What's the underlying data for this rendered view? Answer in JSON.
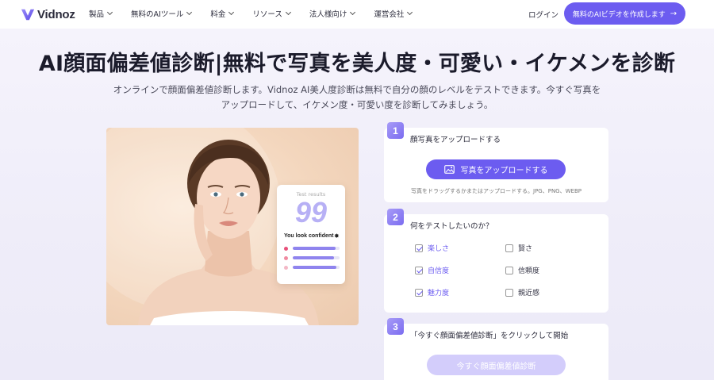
{
  "brand": {
    "name": "Vidnoz",
    "accent": "#6c5cf0"
  },
  "nav": {
    "items": [
      {
        "label": "製品"
      },
      {
        "label": "無料のAIツール"
      },
      {
        "label": "料金"
      },
      {
        "label": "リソース"
      },
      {
        "label": "法人様向け"
      },
      {
        "label": "運営会社"
      }
    ],
    "login": "ログイン",
    "cta": "無料のAIビデオを作成します",
    "cta_icon": "arrow-right-icon"
  },
  "hero": {
    "title": "AI顔面偏差値診断|無料で写真を美人度・可愛い・イケメンを診断",
    "subtitle_line1": "オンラインで顔面偏差値診断します。Vidnoz AI美人度診断は無料で自分の顔のレベルをテストできます。今すぐ写真を",
    "subtitle_line2": "アップロードして、イケメン度・可愛い度を診断してみましょう。"
  },
  "result_card": {
    "label": "Test results",
    "score": "99",
    "text": "You look confident",
    "bars": [
      {
        "icon": "heart-icon",
        "color": "#e8507a",
        "fill": 0.92
      },
      {
        "icon": "crown-icon",
        "color": "#f08aa0",
        "fill": 0.88
      },
      {
        "icon": "sparkle-icon",
        "color": "#f3b8c6",
        "fill": 0.94
      }
    ]
  },
  "steps": {
    "step1": {
      "number": "1",
      "title": "顔写真をアップロードする",
      "button": "写真をアップロードする",
      "hint": "写真をドラッグするかまたはアップロードする。JPG、PNG、WEBP"
    },
    "step2": {
      "number": "2",
      "title": "何をテストしたいのか？",
      "options": [
        {
          "label": "楽しさ",
          "checked": true
        },
        {
          "label": "賢さ",
          "checked": false
        },
        {
          "label": "自信度",
          "checked": true
        },
        {
          "label": "信頼度",
          "checked": false
        },
        {
          "label": "魅力度",
          "checked": true
        },
        {
          "label": "親近感",
          "checked": false
        }
      ]
    },
    "step3": {
      "number": "3",
      "title": "「今すぐ顔面偏差値診断」をクリックして開始",
      "button": "今すぐ顔面偏差値診断"
    }
  }
}
